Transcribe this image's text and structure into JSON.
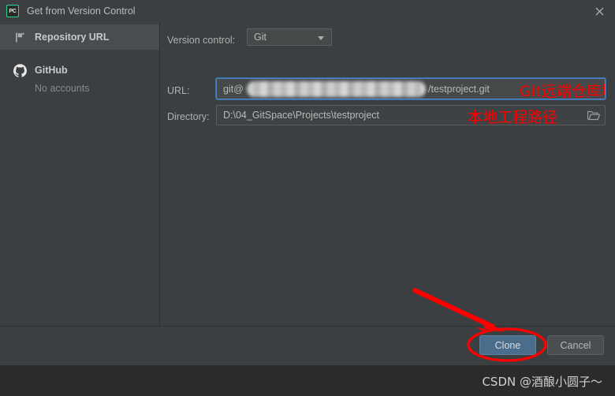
{
  "window": {
    "title": "Get from Version Control",
    "app_icon_label": "PC",
    "close_label": "×"
  },
  "sidebar": {
    "items": [
      {
        "label": "Repository URL",
        "icon": "branch-icon",
        "selected": true,
        "sublabel": ""
      },
      {
        "label": "GitHub",
        "icon": "github-icon",
        "selected": false,
        "sublabel": "No accounts"
      }
    ]
  },
  "form": {
    "version_control": {
      "label": "Version control:",
      "value": "Git",
      "options": [
        "Git"
      ]
    },
    "url": {
      "label": "URL:",
      "prefix": "git@",
      "redacted": true,
      "suffix": "/testproject.git",
      "annotation": "Git远端仓库地址",
      "focused": true
    },
    "directory": {
      "label": "Directory:",
      "value": "D:\\04_GitSpace\\Projects\\testproject",
      "annotation": "本地工程路径",
      "browse_icon": "folder-icon"
    }
  },
  "footer": {
    "clone_label": "Clone",
    "cancel_label": "Cancel"
  },
  "annotations": {
    "color": "#fe0000",
    "arrow": "red-arrow-pointing-to-clone",
    "ellipse": "red-ellipse-around-clone"
  },
  "watermark": {
    "text": "CSDN @酒酿小圆子～"
  },
  "colors": {
    "dialog_bg": "#3c3f41",
    "panel_outside": "#2b2b2b",
    "selected_row": "#4a4d4f",
    "field_bg": "#45494a",
    "focus_border": "#4a88c7",
    "primary_button": "#4a6d8c",
    "annotation_red": "#fe0000",
    "accent_green": "#21d789"
  }
}
